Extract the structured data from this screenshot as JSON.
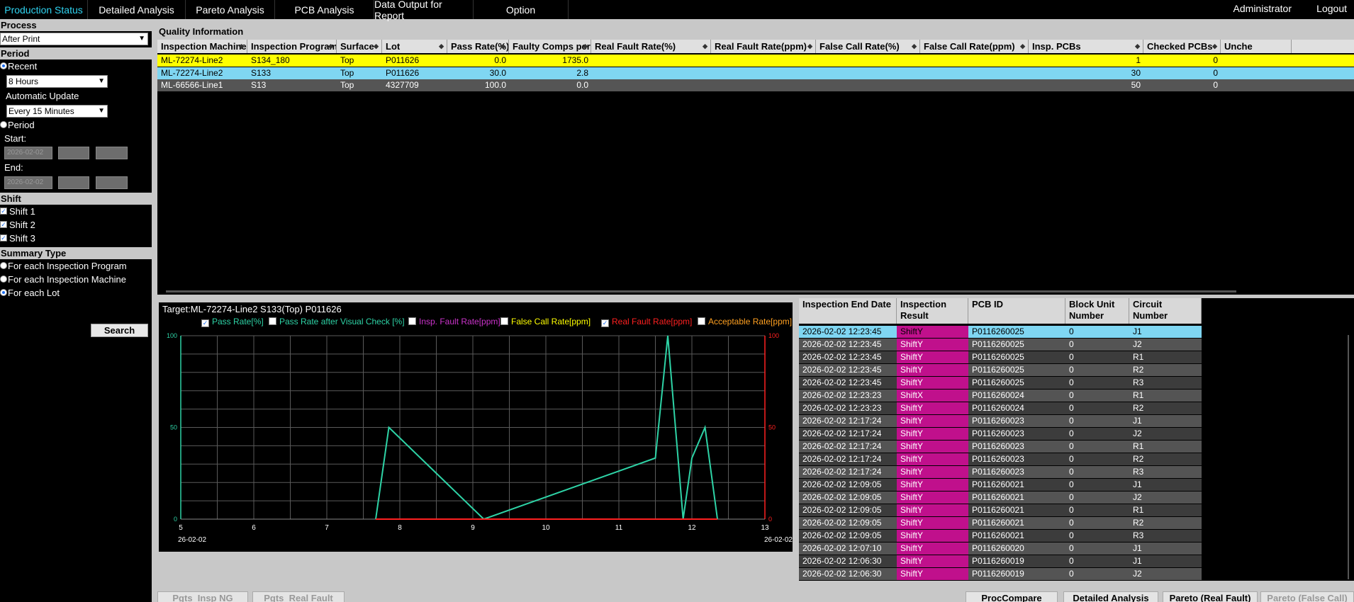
{
  "nav": {
    "tabs": [
      {
        "label": "Production Status",
        "active": true
      },
      {
        "label": "Detailed Analysis"
      },
      {
        "label": "Pareto Analysis"
      },
      {
        "label": "PCB Analysis"
      },
      {
        "label": "Data Output for Report"
      },
      {
        "label": "Option"
      }
    ],
    "user": "Administrator",
    "logout": "Logout"
  },
  "sidebar": {
    "process_label": "Process",
    "process_value": "After Print",
    "period_label": "Period",
    "recent_label": "Recent",
    "recent_value": "8 Hours",
    "auto_update_label": "Automatic Update",
    "auto_update_value": "Every 15 Minutes",
    "period_option_label": "Period",
    "start_label": "Start:",
    "end_label": "End:",
    "start_date": "2026-02-02",
    "end_date": "2026-02-02",
    "shift_label": "Shift",
    "shifts": [
      "Shift 1",
      "Shift 2",
      "Shift 3"
    ],
    "summary_label": "Summary Type",
    "summary_options": [
      "For each Inspection Program",
      "For each Inspection Machine",
      "For each Lot"
    ],
    "search_label": "Search"
  },
  "quality": {
    "title": "Quality Information",
    "columns": [
      "Inspection Machine",
      "Inspection Program",
      "Surface",
      "Lot",
      "Pass Rate(%)",
      "Faulty Comps per PCB",
      "Real Fault Rate(%)",
      "Real Fault Rate(ppm)",
      "False Call Rate(%)",
      "False Call Rate(ppm)",
      "Insp. PCBs",
      "Checked PCBs",
      "Unche"
    ],
    "rows": [
      {
        "machine": "ML-72274-Line2",
        "program": "S134_180",
        "surface": "Top",
        "lot": "P011626",
        "pass": "0.0",
        "faulty": "1735.0",
        "insp": "1",
        "checked": "0",
        "bg": "#ffff00",
        "fg": "#000000"
      },
      {
        "machine": "ML-72274-Line2",
        "program": "S133",
        "surface": "Top",
        "lot": "P011626",
        "pass": "30.0",
        "faulty": "2.8",
        "insp": "30",
        "checked": "0",
        "bg": "#7fd6f2",
        "fg": "#000000"
      },
      {
        "machine": "ML-66566-Line1",
        "program": "S13",
        "surface": "Top",
        "lot": "4327709",
        "pass": "100.0",
        "faulty": "0.0",
        "insp": "50",
        "checked": "0",
        "bg": "#555555",
        "fg": "#ffffff"
      }
    ]
  },
  "chart_data": {
    "type": "line",
    "title": "Target:ML-72274-Line2 S133(Top) P011626",
    "legend": [
      {
        "label": "Pass Rate[%]",
        "checked": true,
        "color": "#2ed3a6"
      },
      {
        "label": "Pass Rate after Visual Check [%]",
        "checked": false,
        "color": "#2ed3a6"
      },
      {
        "label": "Insp. Fault Rate[ppm]",
        "checked": false,
        "color": "#cc33cc"
      },
      {
        "label": "False Call Rate[ppm]",
        "checked": false,
        "color": "#ffff00"
      },
      {
        "label": "Real Fault Rate[ppm]",
        "checked": true,
        "color": "#ff2020"
      },
      {
        "label": "Acceptable Rate[ppm]",
        "checked": false,
        "color": "#ffa020"
      }
    ],
    "xlim": [
      5,
      13
    ],
    "ylim": [
      0,
      100
    ],
    "x_ticks": [
      5,
      6,
      7,
      8,
      9,
      10,
      11,
      12,
      13
    ],
    "y_ticks_left": [
      0,
      50,
      100
    ],
    "y_ticks_right": [
      0,
      50,
      100
    ],
    "date_left": "26-02-02",
    "date_right": "26-02-02",
    "series": [
      {
        "name": "Pass Rate[%]",
        "color": "#2ed3a6",
        "x": [
          7.67,
          7.85,
          9.15,
          11.5,
          11.67,
          11.88,
          12.0,
          12.18,
          12.35
        ],
        "y": [
          0,
          50,
          0,
          33.3,
          100,
          0,
          33.3,
          50,
          0
        ]
      },
      {
        "name": "Real Fault Rate[ppm]",
        "color": "#ff2020",
        "x": [
          7.67,
          12.35
        ],
        "y": [
          0,
          0
        ]
      }
    ]
  },
  "list": {
    "columns": [
      "Inspection End Date",
      "Inspection Result",
      "PCB ID",
      "Block Unit Number",
      "Circuit Number"
    ],
    "rows": [
      [
        "2026-02-02 12:23:45",
        "ShiftY",
        "P0116260025",
        "0",
        "J1"
      ],
      [
        "2026-02-02 12:23:45",
        "ShiftY",
        "P0116260025",
        "0",
        "J2"
      ],
      [
        "2026-02-02 12:23:45",
        "ShiftY",
        "P0116260025",
        "0",
        "R1"
      ],
      [
        "2026-02-02 12:23:45",
        "ShiftY",
        "P0116260025",
        "0",
        "R2"
      ],
      [
        "2026-02-02 12:23:45",
        "ShiftY",
        "P0116260025",
        "0",
        "R3"
      ],
      [
        "2026-02-02 12:23:23",
        "ShiftX",
        "P0116260024",
        "0",
        "R1"
      ],
      [
        "2026-02-02 12:23:23",
        "ShiftY",
        "P0116260024",
        "0",
        "R2"
      ],
      [
        "2026-02-02 12:17:24",
        "ShiftY",
        "P0116260023",
        "0",
        "J1"
      ],
      [
        "2026-02-02 12:17:24",
        "ShiftY",
        "P0116260023",
        "0",
        "J2"
      ],
      [
        "2026-02-02 12:17:24",
        "ShiftY",
        "P0116260023",
        "0",
        "R1"
      ],
      [
        "2026-02-02 12:17:24",
        "ShiftY",
        "P0116260023",
        "0",
        "R2"
      ],
      [
        "2026-02-02 12:17:24",
        "ShiftY",
        "P0116260023",
        "0",
        "R3"
      ],
      [
        "2026-02-02 12:09:05",
        "ShiftY",
        "P0116260021",
        "0",
        "J1"
      ],
      [
        "2026-02-02 12:09:05",
        "ShiftY",
        "P0116260021",
        "0",
        "J2"
      ],
      [
        "2026-02-02 12:09:05",
        "ShiftY",
        "P0116260021",
        "0",
        "R1"
      ],
      [
        "2026-02-02 12:09:05",
        "ShiftY",
        "P0116260021",
        "0",
        "R2"
      ],
      [
        "2026-02-02 12:09:05",
        "ShiftY",
        "P0116260021",
        "0",
        "R3"
      ],
      [
        "2026-02-02 12:07:10",
        "ShiftY",
        "P0116260020",
        "0",
        "J1"
      ],
      [
        "2026-02-02 12:06:30",
        "ShiftY",
        "P0116260019",
        "0",
        "J1"
      ],
      [
        "2026-02-02 12:06:30",
        "ShiftY",
        "P0116260019",
        "0",
        "J2"
      ]
    ]
  },
  "buttons": [
    {
      "label": "Pgts_Insp NG",
      "enabled": false
    },
    {
      "label": "Pgts_Real Fault",
      "enabled": false
    },
    {
      "label": "ProcCompare",
      "enabled": true
    },
    {
      "label": "Detailed Analysis",
      "enabled": true
    },
    {
      "label": "Pareto (Real Fault)",
      "enabled": true
    },
    {
      "label": "Pareto (False Call)",
      "enabled": false
    }
  ],
  "colors": {
    "accent": "#2fd3f0",
    "selected_row": "#7fd6f2",
    "highlight_row": "#ffff00",
    "result_cell": "#c0108c"
  }
}
